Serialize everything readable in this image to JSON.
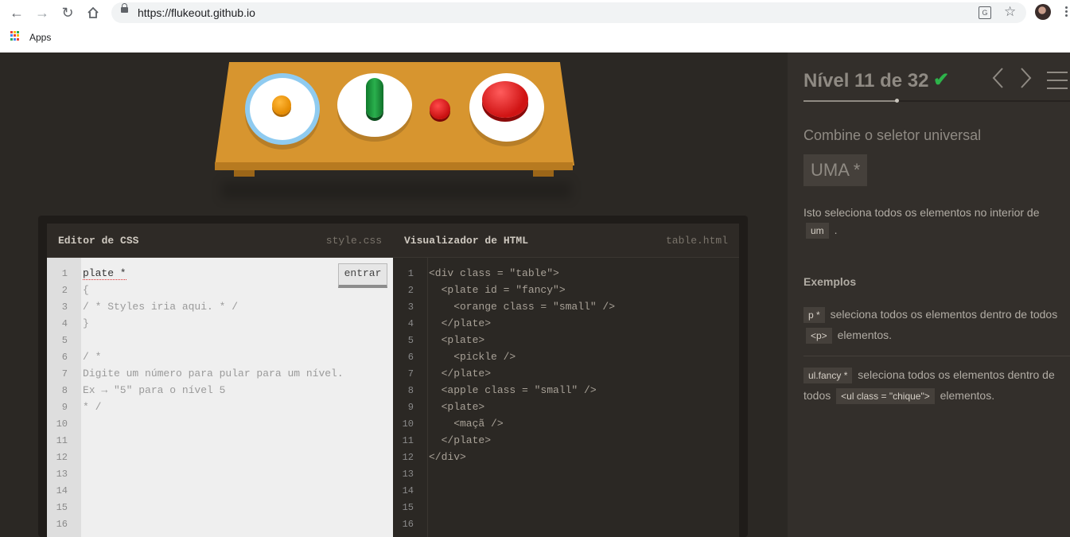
{
  "browser": {
    "url": "https://flukeout.github.io",
    "bookmark_apps": "Apps",
    "translate_icon": "G"
  },
  "editor": {
    "css_title": "Editor de CSS",
    "css_file": "style.css",
    "html_title": "Visualizador de HTML",
    "html_file": "table.html",
    "enter_label": "entrar",
    "line_numbers": [
      "1",
      "2",
      "3",
      "4",
      "5",
      "6",
      "7",
      "8",
      "9",
      "10",
      "11",
      "12",
      "13",
      "14",
      "15",
      "16"
    ],
    "css_input": "plate *",
    "css_lines": [
      "{",
      "/ * Styles iria aqui. * /",
      "}",
      "",
      "/ *",
      "Digite um número para pular para um nível.",
      "Ex → \"5\" para o nível 5",
      "* /"
    ],
    "html_lines": [
      "<div class = \"table\">",
      "  <plate id = \"fancy\">",
      "    <orange class = \"small\" />",
      "  </plate>",
      "  <plate>",
      "    <pickle />",
      "  </plate>",
      "  <apple class = \"small\" />",
      "  <plate>",
      "    <maçã />",
      "  </plate>",
      "</div>"
    ]
  },
  "sidebar": {
    "level": "Nível 11 de 32",
    "level_progress": 0.34,
    "completed": true,
    "subtitle": "Combine o seletor universal",
    "selector": "UMA *",
    "desc_prefix": "Isto seleciona todos os elementos no interior de",
    "desc_tag": "um",
    "desc_suffix": ".",
    "examples_heading": "Exemplos",
    "examples": [
      {
        "code": "p *",
        "text1": "seleciona todos os elementos dentro de todos",
        "tag": "<p>",
        "text2": "elementos."
      },
      {
        "code": "ul.fancy *",
        "text1": "seleciona todos os elementos dentro de todos",
        "tag": "<ul class = \"chique\">",
        "text2": "elementos."
      }
    ]
  },
  "colors": {
    "background": "#2b2824",
    "sidebar": "#332f2b",
    "accent_check": "#2db34a",
    "table": "#d7952f"
  }
}
